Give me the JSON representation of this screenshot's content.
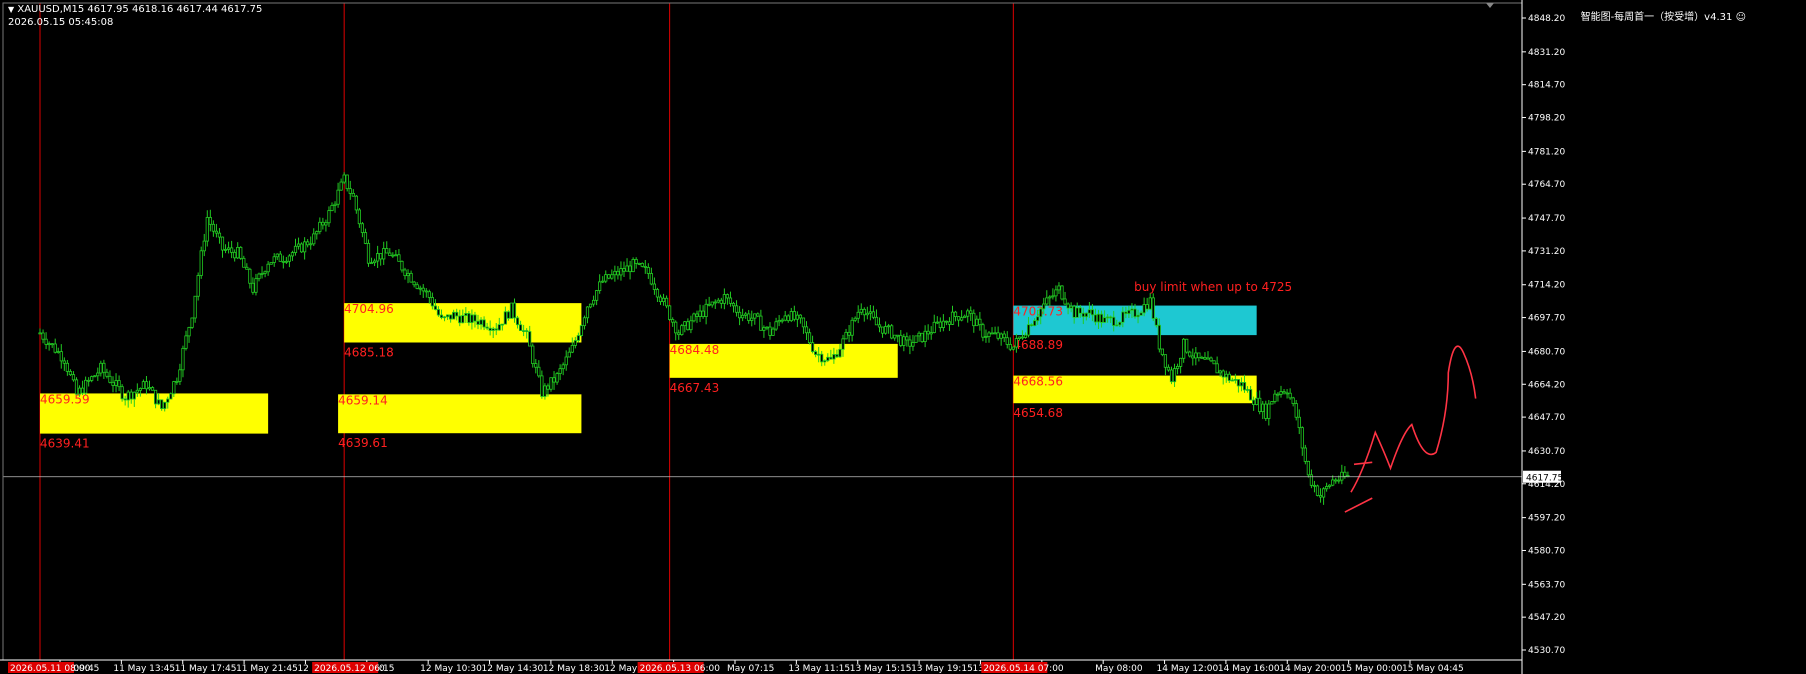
{
  "header": {
    "symbol_ohlc": "XAUUSD,M15  4617.95 4618.16 4617.44 4617.75",
    "datetime": "2026.05.15 05:45:08",
    "indicator_label": "智能图-每周首一（按受增）v4.31"
  },
  "colors": {
    "background": "#000000",
    "candle": "#22cc22",
    "zone": "#ffff00",
    "zone_cyan": "#1ec8d2",
    "zone_label": "#ff2020",
    "divider": "#dd0000",
    "axis": "#ffffff",
    "price_line": "#c0c0c0",
    "drawing": "#ff3344"
  },
  "chart_data": {
    "type": "candlestick",
    "symbol": "XAUUSD",
    "timeframe": "M15",
    "y_ticks": [
      "4848.20",
      "4831.20",
      "4814.70",
      "4798.20",
      "4781.20",
      "4764.70",
      "4747.70",
      "4731.20",
      "4714.20",
      "4697.70",
      "4680.70",
      "4664.20",
      "4647.70",
      "4630.70",
      "4614.20",
      "4597.20",
      "4580.70",
      "4563.70",
      "4547.20",
      "4530.70"
    ],
    "ylim": [
      4530.7,
      4848.2
    ],
    "current_price": "4617.75",
    "x_ticks": [
      "May 09:45",
      "11 May 13:45",
      "11 May 17:45",
      "11 May 21:45",
      "12 M",
      "06:30",
      "12 May 10:30",
      "12 May 14:30",
      "12 May 18:30",
      "12 May 22:30",
      "1",
      "May 07:15",
      "13 May 11:15",
      "13 May 15:15",
      "13 May 19:15",
      "13 May 23:15",
      "",
      "May 08:00",
      "14 May 12:00",
      "14 May 16:00",
      "14 May 20:00",
      "15 May 00:00",
      "15 May 04:45"
    ],
    "session_markers": [
      {
        "index": 0,
        "label": "2026.05.11 08:00"
      },
      {
        "index": 100,
        "label": "2026.05.12 06:15"
      },
      {
        "index": 207,
        "label": "2026.05.13 06:00"
      },
      {
        "index": 320,
        "label": "2026.05.14 07:00"
      }
    ],
    "zones": [
      {
        "start": 0,
        "end": 75,
        "high": 4659.59,
        "low": 4639.41,
        "high_label": "4659.59",
        "low_label": "4639.41",
        "fill": "yellow"
      },
      {
        "start": 98,
        "end": 178,
        "high": 4659.14,
        "low": 4639.61,
        "high_label": "4659.14",
        "low_label": "4639.61",
        "fill": "yellow"
      },
      {
        "start": 100,
        "end": 178,
        "high": 4704.96,
        "low": 4685.18,
        "high_label": "4704.96",
        "low_label": "4685.18",
        "fill": "yellow"
      },
      {
        "start": 207,
        "end": 282,
        "high": 4684.48,
        "low": 4667.43,
        "high_label": "4684.48",
        "low_label": "4667.43",
        "fill": "yellow"
      },
      {
        "start": 320,
        "end": 400,
        "high": 4703.73,
        "low": 4688.89,
        "high_label": "4703.73",
        "low_label": "4688.89",
        "fill": "cyan"
      },
      {
        "start": 320,
        "end": 400,
        "high": 4668.56,
        "low": 4654.68,
        "high_label": "4668.56",
        "low_label": "4654.68",
        "fill": "yellow"
      }
    ],
    "annotation": {
      "text": "buy limit when up to 4725",
      "index": 363,
      "price": 4711
    },
    "path_points": [
      [
        0,
        4690
      ],
      [
        8,
        4677
      ],
      [
        12,
        4659
      ],
      [
        20,
        4672
      ],
      [
        28,
        4658
      ],
      [
        35,
        4664
      ],
      [
        40,
        4652
      ],
      [
        45,
        4668
      ],
      [
        50,
        4700
      ],
      [
        55,
        4748
      ],
      [
        60,
        4732
      ],
      [
        65,
        4730
      ],
      [
        70,
        4712
      ],
      [
        75,
        4726
      ],
      [
        80,
        4728
      ],
      [
        85,
        4732
      ],
      [
        90,
        4738
      ],
      [
        95,
        4750
      ],
      [
        100,
        4767
      ],
      [
        103,
        4758
      ],
      [
        108,
        4728
      ],
      [
        115,
        4730
      ],
      [
        122,
        4718
      ],
      [
        128,
        4708
      ],
      [
        132,
        4696
      ],
      [
        136,
        4699
      ],
      [
        140,
        4697
      ],
      [
        145,
        4696
      ],
      [
        150,
        4693
      ],
      [
        155,
        4702
      ],
      [
        160,
        4688
      ],
      [
        165,
        4660
      ],
      [
        170,
        4668
      ],
      [
        175,
        4682
      ],
      [
        180,
        4704
      ],
      [
        185,
        4716
      ],
      [
        190,
        4720
      ],
      [
        195,
        4724
      ],
      [
        200,
        4720
      ],
      [
        205,
        4705
      ],
      [
        210,
        4690
      ],
      [
        215,
        4697
      ],
      [
        220,
        4703
      ],
      [
        225,
        4708
      ],
      [
        230,
        4700
      ],
      [
        235,
        4697
      ],
      [
        240,
        4690
      ],
      [
        245,
        4700
      ],
      [
        250,
        4695
      ],
      [
        255,
        4680
      ],
      [
        260,
        4676
      ],
      [
        265,
        4688
      ],
      [
        270,
        4704
      ],
      [
        275,
        4694
      ],
      [
        280,
        4690
      ],
      [
        285,
        4684
      ],
      [
        290,
        4688
      ],
      [
        295,
        4694
      ],
      [
        300,
        4698
      ],
      [
        305,
        4700
      ],
      [
        310,
        4690
      ],
      [
        315,
        4688
      ],
      [
        320,
        4683
      ],
      [
        325,
        4694
      ],
      [
        330,
        4704
      ],
      [
        335,
        4712
      ],
      [
        340,
        4700
      ],
      [
        345,
        4700
      ],
      [
        350,
        4696
      ],
      [
        355,
        4697
      ],
      [
        360,
        4700
      ],
      [
        365,
        4706
      ],
      [
        368,
        4684
      ],
      [
        372,
        4667
      ],
      [
        376,
        4684
      ],
      [
        380,
        4677
      ],
      [
        385,
        4674
      ],
      [
        390,
        4668
      ],
      [
        395,
        4664
      ],
      [
        400,
        4655
      ],
      [
        403,
        4650
      ],
      [
        406,
        4660
      ],
      [
        410,
        4662
      ],
      [
        413,
        4648
      ],
      [
        417,
        4618
      ],
      [
        421,
        4608
      ],
      [
        425,
        4616
      ],
      [
        430,
        4617.75
      ]
    ],
    "total_bars": 430,
    "future_bars": 50
  }
}
